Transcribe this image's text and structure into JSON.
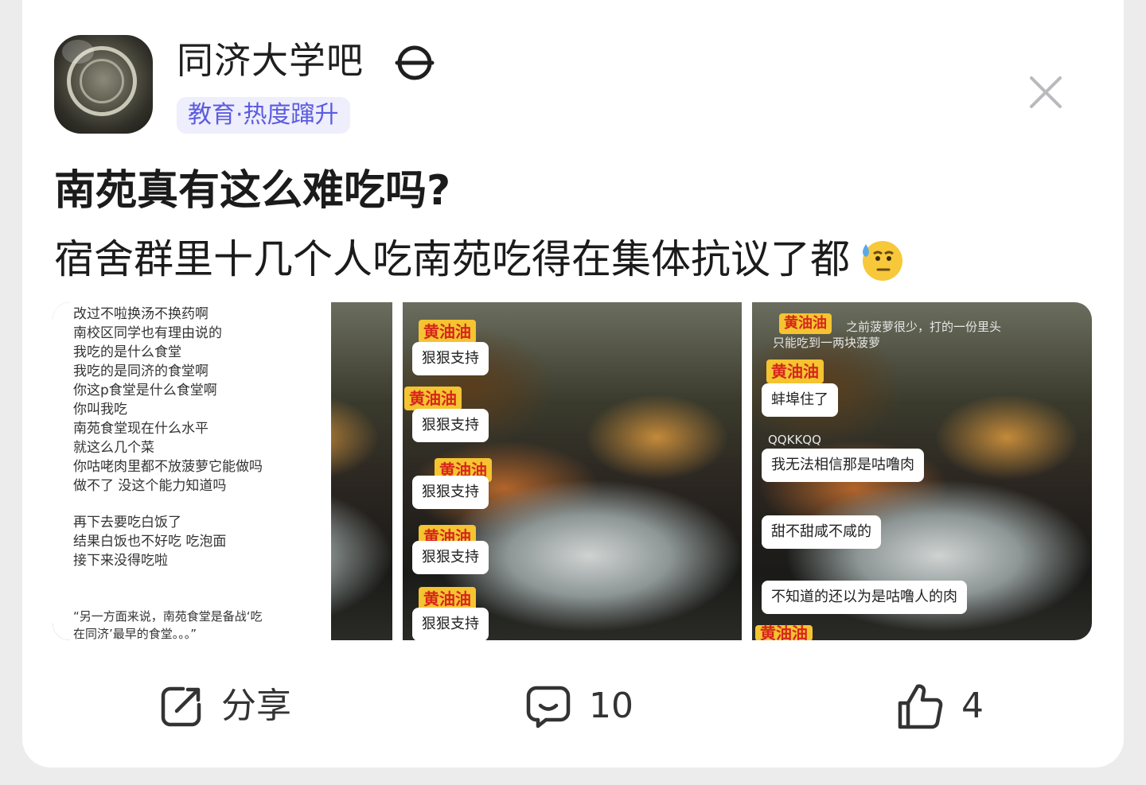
{
  "forum": {
    "name": "同济大学吧",
    "tag": "教育·热度蹿升",
    "follow_icon": "follow-circle-icon",
    "close_icon": "close-icon"
  },
  "post": {
    "title": "南苑真有这么难吃吗?",
    "body": "宿舍群里十几个人吃南苑吃得在集体抗议了都",
    "emoji": "sweat-face-emoji"
  },
  "images": [
    {
      "chat_lines": [
        "改过不啦换汤不换药啊",
        "南校区同学也有理由说的",
        "我吃的是什么食堂",
        "我吃的是同济的食堂啊",
        "你这p食堂是什么食堂啊",
        "你叫我吃",
        "南苑食堂现在什么水平",
        "就这么几个菜",
        "你咕咾肉里都不放菠萝它能做吗",
        "做不了 没这个能力知道吗",
        "再下去要吃白饭了",
        "结果白饭也不好吃 吃泡面",
        "接下来没得吃啦",
        "“另一方面来说，南苑食堂是备战‘吃",
        "在同济’最早的食堂。。。”"
      ]
    },
    {
      "name_tag": "黄油油",
      "bubbles": [
        "狠狠支持",
        "狠狠支持",
        "狠狠支持",
        "狠狠支持",
        "狠狠支持"
      ]
    },
    {
      "faint_top_1": "之前菠萝很少，打的一份里头",
      "faint_top_2": "只能吃到一两块菠萝",
      "name_tag": "黄油油",
      "faint_mid": "QQKKQQ",
      "bubbles": [
        "蚌埠住了",
        "我无法相信那是咕噜肉",
        "甜不甜咸不咸的",
        "不知道的还以为是咕噜人的肉"
      ]
    }
  ],
  "actions": {
    "share_label": "分享",
    "comment_count": "10",
    "like_count": "4"
  },
  "colors": {
    "tag_bg": "#eeeefc",
    "tag_text": "#5c5ce0",
    "name_tag_bg": "#f4c431",
    "name_tag_text": "#d7261c"
  }
}
